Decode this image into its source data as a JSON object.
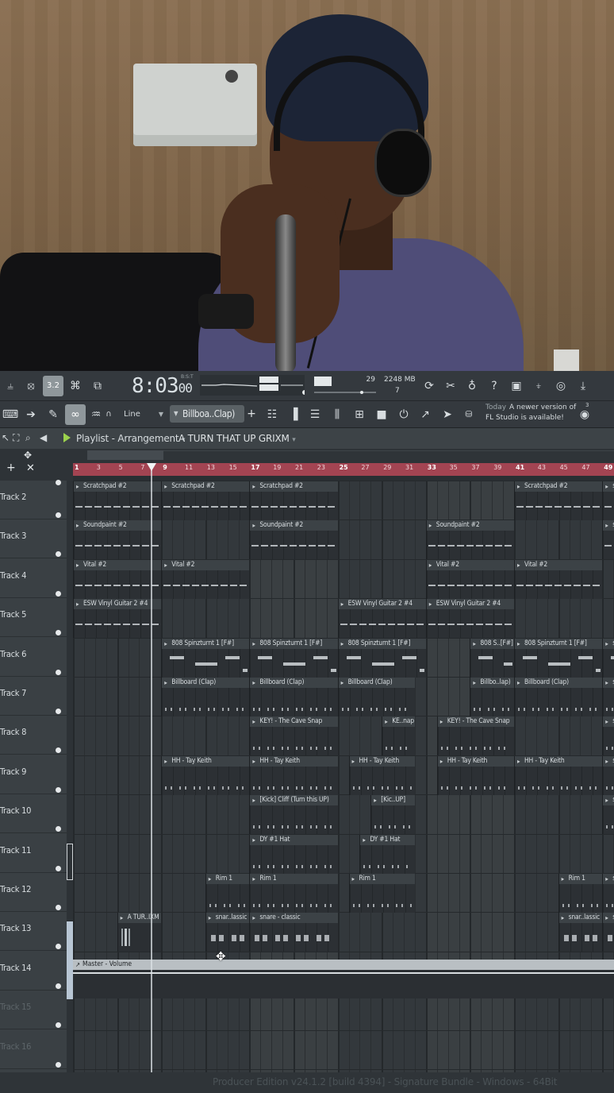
{
  "toolbar": {
    "clock": "8:03",
    "clock_frames": "00",
    "clock_unit": "B:S:T",
    "cpu": "29",
    "memory": "2248 MB",
    "polyphony": "7",
    "snap_mode": "Line",
    "pattern": "Billboa..Clap)",
    "pattern_add": "+",
    "news_today": "Today",
    "news_line1": "A newer version of",
    "news_line2": "FL Studio is available!",
    "news_count": "3"
  },
  "playlist": {
    "title": "Playlist - Arrangement",
    "arrangement": "A TURN THAT UP GRIXM"
  },
  "ruler": [
    "1",
    "3",
    "5",
    "7",
    "9",
    "11",
    "13",
    "15",
    "17",
    "19",
    "21",
    "23",
    "25",
    "27",
    "29",
    "31",
    "33",
    "35",
    "37",
    "39",
    "41",
    "43",
    "45",
    "47",
    "49"
  ],
  "tracks": [
    {
      "name": "Track 2",
      "dim": false
    },
    {
      "name": "Track 3",
      "dim": false
    },
    {
      "name": "Track 4",
      "dim": false
    },
    {
      "name": "Track 5",
      "dim": false
    },
    {
      "name": "Track 6",
      "dim": false
    },
    {
      "name": "Track 7",
      "dim": false
    },
    {
      "name": "Track 8",
      "dim": false
    },
    {
      "name": "Track 9",
      "dim": false
    },
    {
      "name": "Track 10",
      "dim": false
    },
    {
      "name": "Track 11",
      "dim": false
    },
    {
      "name": "Track 12",
      "dim": false
    },
    {
      "name": "Track 13",
      "dim": false
    },
    {
      "name": "Track 14",
      "dim": false
    },
    {
      "name": "Track 15",
      "dim": true
    },
    {
      "name": "Track 16",
      "dim": true
    }
  ],
  "clip_names": {
    "scratchpad": "Scratchpad #2",
    "soundpaint": "Soundpaint #2",
    "vital": "Vital #2",
    "esw": "ESW Vinyl Guitar 2 #4",
    "spinz": "808 Spinzturnt 1 [F#]",
    "spinz_short": "808 S..[F#]",
    "billboard": "Billboard (Clap)",
    "billboard_short": "Billbo..lap)",
    "key": "KEY! - The Cave Snap",
    "key_short": "KE..nap",
    "hh": "HH - Tay Keith",
    "kick": "[Kick] Cliff (Turn this UP)",
    "kick_short": "[Kic..UP]",
    "dy": "DY #1 Hat",
    "rim": "Rim 1",
    "audio": "A TUR..IXM",
    "snare": "snare - classic",
    "snare_short": "snar..lassic",
    "snare_tiny": "s",
    "master": "Master - Volume"
  },
  "status_bar": "Producer Edition v24.1.2 [build 4394] - Signature Bundle - Windows - 64Bit",
  "icons": {
    "toolbar1": [
      "pitch-icon",
      "metronome-icon",
      "tempo-icon",
      "typing-keyboard-icon",
      "step-record-icon"
    ],
    "toolbar1_right": [
      "loop-record-icon",
      "cut-icon",
      "mic-icon",
      "help-icon",
      "save-icon",
      "render-icon",
      "chat-icon",
      "download-icon"
    ],
    "toolbar2": [
      "keyboard-icon",
      "arrow-icon",
      "pencil-icon",
      "link-icon",
      "stamp-icon",
      "magnet-icon"
    ],
    "toolbar2_right": [
      "playlist-icon",
      "piano-roll-icon",
      "channel-rack-icon",
      "mixer-icon",
      "browser-icon",
      "file-icon",
      "plugin-icon",
      "picker-icon",
      "brush-icon",
      "cart-icon",
      "globe-icon"
    ]
  }
}
